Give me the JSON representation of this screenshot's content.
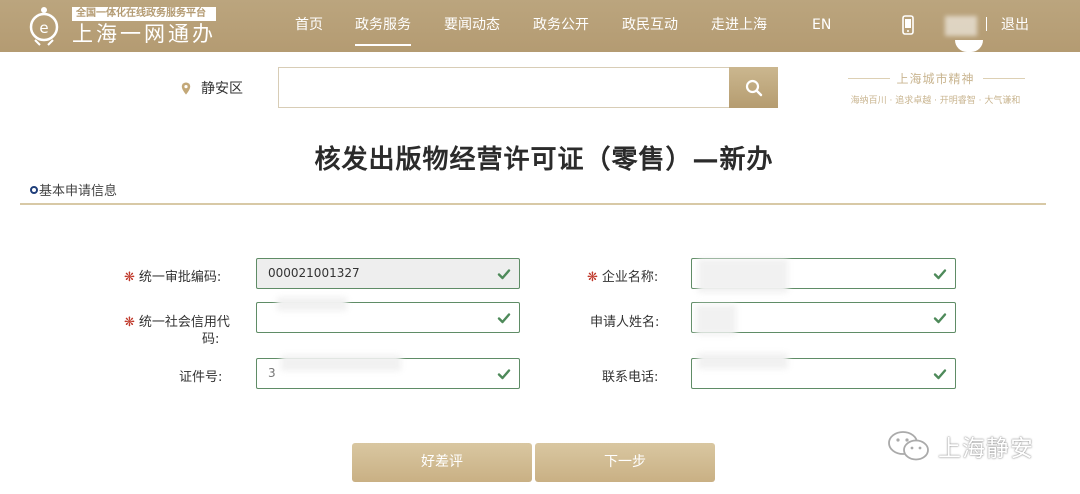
{
  "header": {
    "logo_tagline": "全国一体化在线政务服务平台",
    "logo_name": "上海一网通办",
    "nav": [
      {
        "label": "首页"
      },
      {
        "label": "政务服务"
      },
      {
        "label": "要闻动态"
      },
      {
        "label": "政务公开"
      },
      {
        "label": "政民互动"
      },
      {
        "label": "走进上海"
      },
      {
        "label": "EN"
      }
    ],
    "logout": "退出"
  },
  "search": {
    "location": "静安区",
    "placeholder": ""
  },
  "spirit": {
    "title": "上海城市精神",
    "subtitle": "海纳百川 · 追求卓越 · 开明睿智 · 大气谦和"
  },
  "page_title": "核发出版物经营许可证（零售）—新办",
  "section_label": "基本申请信息",
  "form": {
    "approval_code_label": "统一审批编码:",
    "approval_code_value": "000021001327",
    "company_name_label": "企业名称:",
    "credit_code_label_line1": "统一社会信用代",
    "credit_code_label_line2": "码:",
    "applicant_name_label": "申请人姓名:",
    "id_number_label": "证件号:",
    "id_number_value": "3",
    "phone_label": "联系电话:",
    "required_mark": "❋"
  },
  "buttons": {
    "rating": "好差评",
    "next": "下一步"
  },
  "watermark": "上海静安",
  "colors": {
    "header_bg": "#b49b72",
    "accent_gold": "#c9b084",
    "valid_green": "#5f8c66",
    "required_red": "#c0392b"
  }
}
